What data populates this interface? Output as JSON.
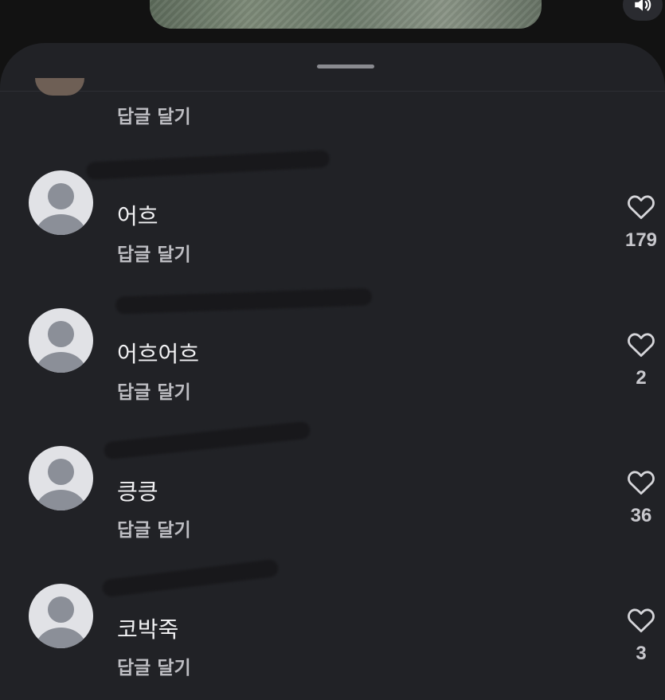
{
  "video": {
    "volume_icon": "volume-icon"
  },
  "sheet": {
    "top_reply_label": "답글 달기"
  },
  "comments": [
    {
      "text": "어흐",
      "reply_label": "답글 달기",
      "likes": "179",
      "icon": "heart-icon"
    },
    {
      "text": "어흐어흐",
      "reply_label": "답글 달기",
      "likes": "2",
      "icon": "heart-icon"
    },
    {
      "text": "킁킁",
      "reply_label": "답글 달기",
      "likes": "36",
      "icon": "heart-icon"
    },
    {
      "text": "코박죽",
      "reply_label": "답글 달기",
      "likes": "3",
      "icon": "heart-icon"
    }
  ],
  "colors": {
    "sheet_background": "#212226",
    "avatar_background": "#e1e2e6",
    "avatar_figure": "#8b8f98",
    "reply_text": "#bdbdc2",
    "comment_text": "#f2f2f4"
  }
}
